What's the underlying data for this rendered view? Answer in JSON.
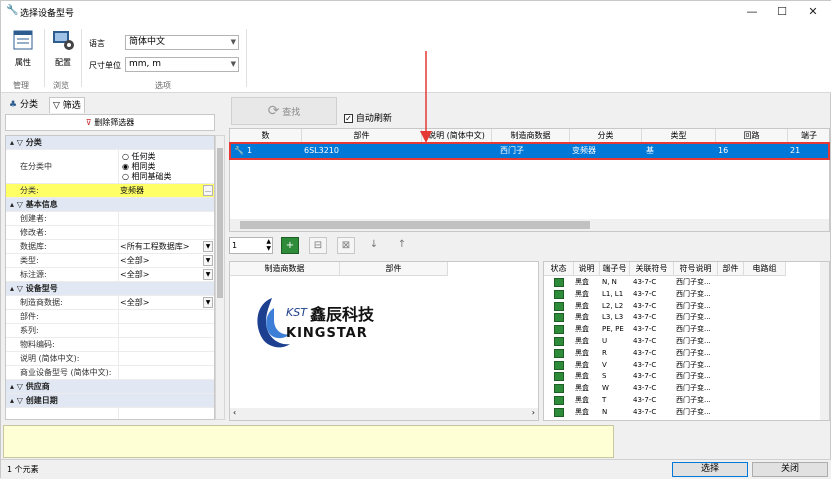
{
  "window": {
    "title": "选择设备型号",
    "minimize": "—",
    "maximize": "☐",
    "close": "✕"
  },
  "ribbon": {
    "btn_properties": "属性",
    "btn_config": "配置",
    "group_manage": "管理",
    "group_browse": "浏览",
    "group_options": "选项",
    "language_label": "语言",
    "language_value": "简体中文",
    "unit_label": "尺寸单位",
    "unit_value": "mm, m"
  },
  "left": {
    "tab_classify": "分类",
    "tab_filter": "筛选",
    "delete_filter": "删除筛选器",
    "rows": [
      {
        "type": "cat",
        "label": "分类"
      },
      {
        "type": "field",
        "label": "在分类中",
        "val": ""
      },
      {
        "type": "field",
        "label": "分类:",
        "val": "变频器"
      },
      {
        "type": "cat",
        "label": "基本信息"
      },
      {
        "type": "field",
        "label": "创建者:",
        "val": ""
      },
      {
        "type": "field",
        "label": "修改者:",
        "val": ""
      },
      {
        "type": "field",
        "label": "数据库:",
        "val": "<所有工程数据库>"
      },
      {
        "type": "field",
        "label": "类型:",
        "val": "<全部>"
      },
      {
        "type": "field",
        "label": "标注源:",
        "val": "<全部>"
      },
      {
        "type": "cat",
        "label": "设备型号"
      },
      {
        "type": "field",
        "label": "制造商数据:",
        "val": "<全部>"
      },
      {
        "type": "field",
        "label": "部件:",
        "val": ""
      },
      {
        "type": "field",
        "label": "系列:",
        "val": ""
      },
      {
        "type": "field",
        "label": "物料编码:",
        "val": ""
      },
      {
        "type": "field",
        "label": "说明 (简体中文):",
        "val": ""
      },
      {
        "type": "field",
        "label": "商业设备型号 (简体中文):",
        "val": ""
      },
      {
        "type": "cat",
        "label": "供应商"
      },
      {
        "type": "cat",
        "label": "创建日期"
      }
    ],
    "radio_any": "任何类",
    "radio_same": "相同类",
    "radio_base": "相同基础类"
  },
  "search": {
    "button": "查找",
    "auto_refresh": "自动刷新"
  },
  "grid1": {
    "headers": [
      "数",
      "部件",
      "说明 (简体中文)",
      "制造商数据",
      "分类",
      "类型",
      "回路",
      "端子"
    ],
    "row": [
      "1",
      "6SL3210",
      "",
      "西门子",
      "变频器",
      "基",
      "16",
      "21"
    ]
  },
  "qty": "1",
  "image_panel": {
    "headers": [
      "制造商数据",
      "部件"
    ],
    "logo_kst": "KST",
    "logo_cn": "鑫辰科技",
    "logo_en": "KINGSTAR"
  },
  "connections": {
    "headers": [
      "状态",
      "说明",
      "端子号",
      "关联符号",
      "符号说明",
      "部件",
      "电路组"
    ],
    "rows": [
      [
        "黑盒",
        "N, N",
        "43-7-C",
        "西门子变..."
      ],
      [
        "黑盒",
        "L1, L1",
        "43-7-C",
        "西门子变..."
      ],
      [
        "黑盒",
        "L2, L2",
        "43-7-C",
        "西门子变..."
      ],
      [
        "黑盒",
        "L3, L3",
        "43-7-C",
        "西门子变..."
      ],
      [
        "黑盒",
        "PE, PE",
        "43-7-C",
        "西门子变..."
      ],
      [
        "黑盒",
        "U",
        "43-7-C",
        "西门子变..."
      ],
      [
        "黑盒",
        "R",
        "43-7-C",
        "西门子变..."
      ],
      [
        "黑盒",
        "V",
        "43-7-C",
        "西门子变..."
      ],
      [
        "黑盒",
        "S",
        "43-7-C",
        "西门子变..."
      ],
      [
        "黑盒",
        "W",
        "43-7-C",
        "西门子变..."
      ],
      [
        "黑盒",
        "T",
        "43-7-C",
        "西门子变..."
      ],
      [
        "黑盒",
        "N",
        "43-7-C",
        "西门子变..."
      ]
    ]
  },
  "status_text": "1 个元素",
  "buttons": {
    "select": "选择",
    "close": "关闭"
  },
  "colors": {
    "selection": "#0078d7",
    "highlight": "#ffff66",
    "annotation": "#e53935"
  }
}
